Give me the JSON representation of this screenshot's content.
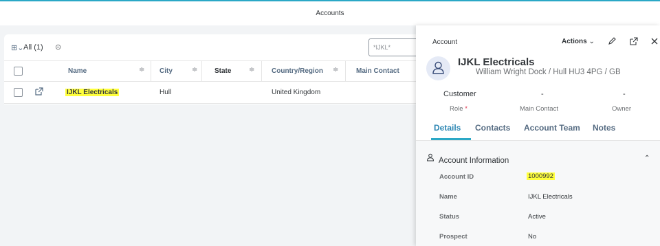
{
  "shell": {
    "title": "Accounts"
  },
  "list": {
    "view_label": "All (1)",
    "search_value": "*IJKL*",
    "columns": [
      "Name",
      "City",
      "State",
      "Country/Region",
      "Main Contact"
    ],
    "rows": [
      {
        "name": "IJKL Electricals",
        "city": "Hull",
        "state": "",
        "country": "United Kingdom",
        "main_contact": ""
      }
    ]
  },
  "panel": {
    "object_type": "Account",
    "actions_label": "Actions",
    "title": "IJKL Electricals",
    "subtitle": "William Wright Dock / Hull HU3 4PG / GB",
    "key_values": [
      {
        "value": "Customer",
        "label": "Role"
      },
      {
        "value": "-",
        "label": "Main Contact"
      },
      {
        "value": "-",
        "label": "Owner"
      }
    ],
    "required_marker": "*",
    "tabs": [
      "Details",
      "Contacts",
      "Account Team",
      "Notes"
    ],
    "section_title": "Account Information",
    "fields": [
      {
        "label": "Account ID",
        "value": "1000992"
      },
      {
        "label": "Name",
        "value": "IJKL Electricals"
      },
      {
        "label": "Status",
        "value": "Active"
      },
      {
        "label": "Prospect",
        "value": "No"
      }
    ]
  },
  "colors": {
    "accent": "#2ba8c6",
    "highlight": "#ffff3c",
    "required": "#e0364f"
  },
  "icons": [
    "view-selector-icon",
    "view-toggle-icon",
    "open-in-new-icon",
    "actions-chevron-icon",
    "edit-icon",
    "open-external-icon",
    "close-icon",
    "account-avatar-icon",
    "person-icon",
    "collapse-chevron-icon"
  ]
}
